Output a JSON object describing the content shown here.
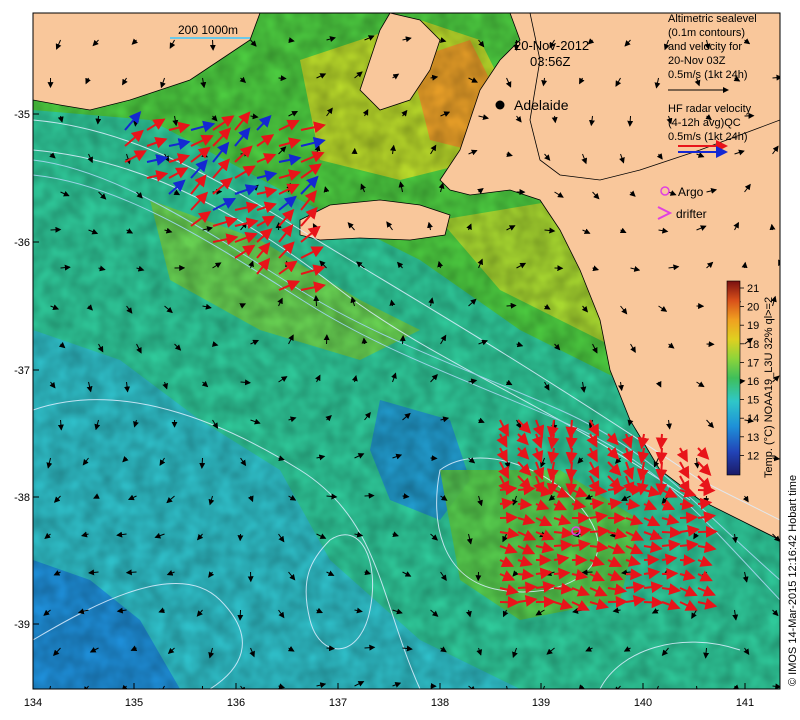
{
  "map": {
    "date": "20-Nov-2012",
    "time": "03:56Z",
    "city": "Adelaide",
    "scale_bar": "200  1000m",
    "legend_altimetry": [
      "Altimetric sealevel",
      "(0.1m contours)",
      "and velocity for",
      "20-Nov 03Z",
      "0.5m/s (1kt 24h)"
    ],
    "legend_hf": [
      "HF radar velocity",
      "(4-12h avg)QC",
      "0.5m/s (1kt 24h)"
    ],
    "legend_argo": "Argo",
    "legend_drifter": "drifter",
    "colorbar_title": "Temp. (°C) NOAA19_L3U 32% ql>=2",
    "colorbar_ticks": [
      "21",
      "20",
      "19",
      "18",
      "17",
      "16",
      "15",
      "14",
      "13",
      "12"
    ],
    "credit": "© IMOS 14-Mar-2015 12:16:42 Hobart time",
    "x_ticks": [
      "134",
      "135",
      "136",
      "137",
      "138",
      "139",
      "140",
      "141"
    ],
    "y_ticks": [
      "-35",
      "-36",
      "-37",
      "-38",
      "-39"
    ],
    "colors": {
      "land": "#F9C79B",
      "hf_red": "#E8141A",
      "hf_blue": "#1428D2",
      "argo": "#E040E0",
      "contour": "#DDEEFF"
    }
  }
}
